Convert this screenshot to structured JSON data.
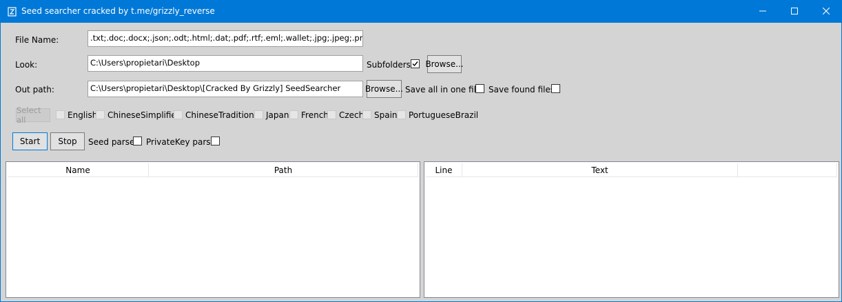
{
  "window": {
    "title": "Seed searcher cracked by t.me/grizzly_reverse"
  },
  "icons": {
    "app": "app-icon",
    "minimize": "minimize-icon",
    "maximize": "maximize-icon",
    "close": "close-icon",
    "check": "checkmark-icon"
  },
  "form": {
    "file_name_label": "File Name:",
    "file_name_value": ".txt;.doc;.docx;.json;.odt;.html;.dat;.pdf;.rtf;.eml;.wallet;.jpg;.jpeg;.png;.tiff",
    "look_label": "Look:",
    "look_value": "C:\\Users\\propietari\\Desktop",
    "subfolders_label": "Subfolders",
    "subfolders_checked": true,
    "browse_label": "Browse...",
    "out_path_label": "Out path:",
    "out_path_value": "C:\\Users\\propietari\\Desktop\\[Cracked By Grizzly] SeedSearcher",
    "browse2_label": "Browse...",
    "save_all_label": "Save all in one file",
    "save_found_label": "Save found files"
  },
  "languages": {
    "select_all_label": "Select all",
    "items": [
      "English",
      "ChineseSimplified",
      "ChineseTraditional",
      "Japan",
      "French",
      "Czech",
      "Spain",
      "PortugueseBrazil"
    ]
  },
  "actions": {
    "start_label": "Start",
    "stop_label": "Stop",
    "seed_parse_label": "Seed parse",
    "privatekey_parse_label": "PrivateKey parse"
  },
  "left_table": {
    "columns": [
      "Name",
      "Path"
    ]
  },
  "right_table": {
    "columns": [
      "Line",
      "Text"
    ]
  }
}
